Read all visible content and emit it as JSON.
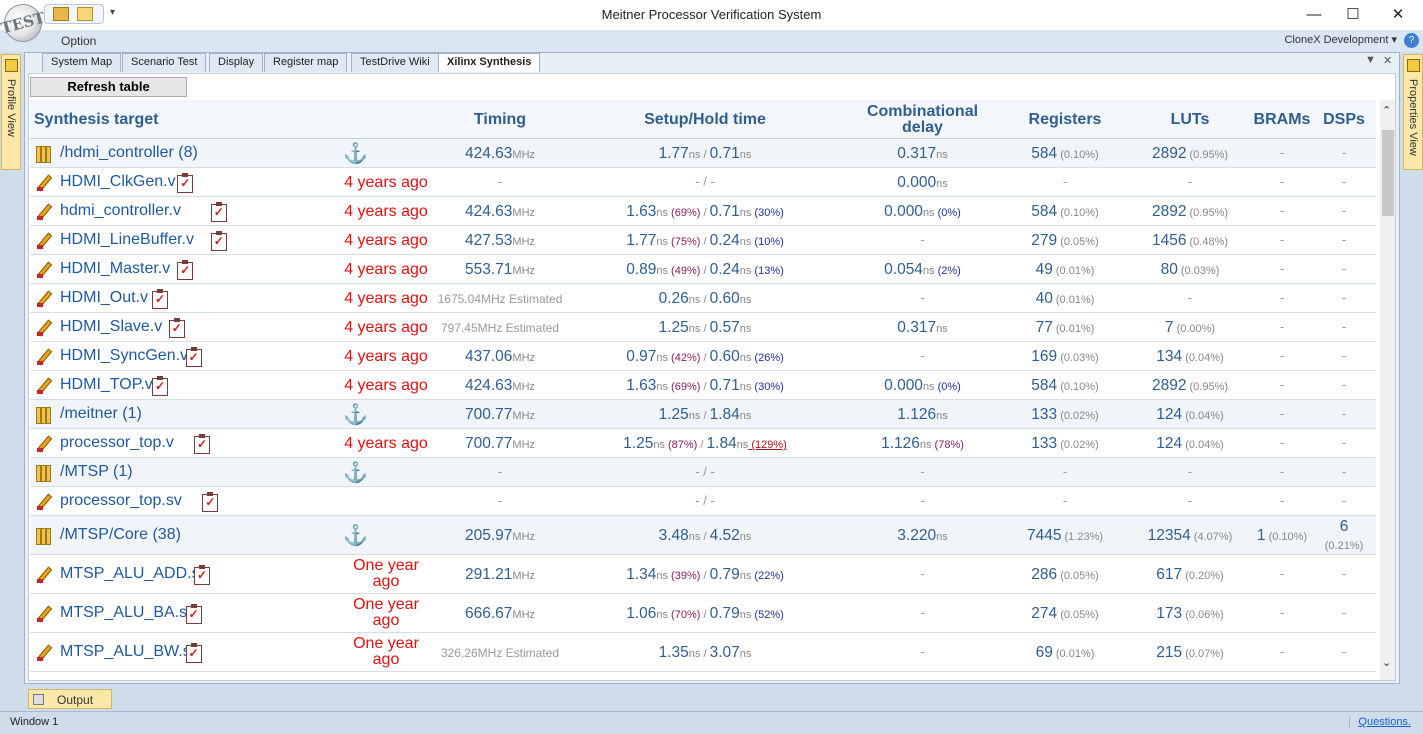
{
  "window": {
    "title": "Meitner Processor Verification System",
    "logo_text": "TEST",
    "minimize": "—",
    "maximize": "☐",
    "close": "✕"
  },
  "menubar": {
    "option": "Option",
    "profile": "CloneX Development",
    "profile_dropdown": "▾",
    "help": "?"
  },
  "side_tabs": {
    "left": "Profile View",
    "right": "Properties View"
  },
  "tabs": [
    {
      "label": "System Map"
    },
    {
      "label": "Scenario Test"
    },
    {
      "label": "Display"
    },
    {
      "label": "Register map"
    },
    {
      "label": "TestDrive Wiki"
    },
    {
      "label": "Xilinx Synthesis"
    }
  ],
  "tab_controls": {
    "dropdown": "▼",
    "close": "✕"
  },
  "refresh_label": "Refresh table",
  "columns": {
    "target": "Synthesis target",
    "timing": "Timing",
    "setup_hold": "Setup/Hold time",
    "comb_line1": "Combinational",
    "comb_line2": "delay",
    "registers": "Registers",
    "luts": "LUTs",
    "brams": "BRAMs",
    "dsps": "DSPs"
  },
  "units": {
    "mhz": "MHz",
    "ns": "ns",
    "estimated": "Estimated",
    "dash": "-",
    "slash": "/"
  },
  "rows": [
    {
      "type": "dir",
      "name": "/hdmi_controller (8)",
      "ago": "",
      "timing": "424.63",
      "setup": "1.77",
      "setup_pct": "",
      "hold": "0.71",
      "hold_pct": "",
      "comb": "0.317",
      "comb_pct": "",
      "reg": "584",
      "reg_pct": "(0.10%)",
      "lut": "2892",
      "lut_pct": "(0.95%)",
      "bram": "-",
      "bram_pct": "",
      "dsp": "-",
      "dsp_pct": ""
    },
    {
      "type": "file",
      "name": "HDMI_ClkGen.v",
      "ago": "4 years ago",
      "timing": "-",
      "setup": "-",
      "setup_pct": "",
      "hold": "-",
      "hold_pct": "",
      "comb": "0.000",
      "comb_pct": "",
      "reg": "-",
      "reg_pct": "",
      "lut": "-",
      "lut_pct": "",
      "bram": "-",
      "bram_pct": "",
      "dsp": "-",
      "dsp_pct": ""
    },
    {
      "type": "file",
      "name": "hdmi_controller.v",
      "ago": "4 years ago",
      "timing": "424.63",
      "setup": "1.63",
      "setup_pct": "(69%)",
      "hold": "0.71",
      "hold_pct": "(30%)",
      "comb": "0.000",
      "comb_pct": "(0%)",
      "reg": "584",
      "reg_pct": "(0.10%)",
      "lut": "2892",
      "lut_pct": "(0.95%)",
      "bram": "-",
      "bram_pct": "",
      "dsp": "-",
      "dsp_pct": ""
    },
    {
      "type": "file",
      "name": "HDMI_LineBuffer.v",
      "ago": "4 years ago",
      "timing": "427.53",
      "setup": "1.77",
      "setup_pct": "(75%)",
      "hold": "0.24",
      "hold_pct": "(10%)",
      "comb": "-",
      "comb_pct": "",
      "reg": "279",
      "reg_pct": "(0.05%)",
      "lut": "1456",
      "lut_pct": "(0.48%)",
      "bram": "-",
      "bram_pct": "",
      "dsp": "-",
      "dsp_pct": ""
    },
    {
      "type": "file",
      "name": "HDMI_Master.v",
      "ago": "4 years ago",
      "timing": "553.71",
      "setup": "0.89",
      "setup_pct": "(49%)",
      "hold": "0.24",
      "hold_pct": "(13%)",
      "comb": "0.054",
      "comb_pct": "(2%)",
      "reg": "49",
      "reg_pct": "(0.01%)",
      "lut": "80",
      "lut_pct": "(0.03%)",
      "bram": "-",
      "bram_pct": "",
      "dsp": "-",
      "dsp_pct": ""
    },
    {
      "type": "file",
      "name": "HDMI_Out.v",
      "ago": "4 years ago",
      "timing": "1675.04",
      "timing_est": true,
      "setup": "0.26",
      "setup_pct": "",
      "hold": "0.60",
      "hold_pct": "",
      "comb": "-",
      "comb_pct": "",
      "reg": "40",
      "reg_pct": "(0.01%)",
      "lut": "-",
      "lut_pct": "",
      "bram": "-",
      "bram_pct": "",
      "dsp": "-",
      "dsp_pct": ""
    },
    {
      "type": "file",
      "name": "HDMI_Slave.v",
      "ago": "4 years ago",
      "timing": "797.45",
      "timing_est": true,
      "setup": "1.25",
      "setup_pct": "",
      "hold": "0.57",
      "hold_pct": "",
      "comb": "0.317",
      "comb_pct": "",
      "reg": "77",
      "reg_pct": "(0.01%)",
      "lut": "7",
      "lut_pct": "(0.00%)",
      "bram": "-",
      "bram_pct": "",
      "dsp": "-",
      "dsp_pct": ""
    },
    {
      "type": "file",
      "name": "HDMI_SyncGen.v",
      "ago": "4 years ago",
      "timing": "437.06",
      "setup": "0.97",
      "setup_pct": "(42%)",
      "hold": "0.60",
      "hold_pct": "(26%)",
      "comb": "-",
      "comb_pct": "",
      "reg": "169",
      "reg_pct": "(0.03%)",
      "lut": "134",
      "lut_pct": "(0.04%)",
      "bram": "-",
      "bram_pct": "",
      "dsp": "-",
      "dsp_pct": ""
    },
    {
      "type": "file",
      "name": "HDMI_TOP.v",
      "ago": "4 years ago",
      "timing": "424.63",
      "setup": "1.63",
      "setup_pct": "(69%)",
      "hold": "0.71",
      "hold_pct": "(30%)",
      "comb": "0.000",
      "comb_pct": "(0%)",
      "reg": "584",
      "reg_pct": "(0.10%)",
      "lut": "2892",
      "lut_pct": "(0.95%)",
      "bram": "-",
      "bram_pct": "",
      "dsp": "-",
      "dsp_pct": ""
    },
    {
      "type": "dir",
      "name": "/meitner (1)",
      "ago": "",
      "timing": "700.77",
      "setup": "1.25",
      "setup_pct": "",
      "hold": "1.84",
      "hold_pct": "",
      "comb": "1.126",
      "comb_pct": "",
      "reg": "133",
      "reg_pct": "(0.02%)",
      "lut": "124",
      "lut_pct": "(0.04%)",
      "bram": "-",
      "bram_pct": "",
      "dsp": "-",
      "dsp_pct": ""
    },
    {
      "type": "file",
      "name": "processor_top.v",
      "ago": "4 years ago",
      "timing": "700.77",
      "setup": "1.25",
      "setup_pct": "(87%)",
      "hold": "1.84",
      "hold_pct": "(129%)",
      "hold_over": true,
      "comb": "1.126",
      "comb_pct": "(78%)",
      "reg": "133",
      "reg_pct": "(0.02%)",
      "lut": "124",
      "lut_pct": "(0.04%)",
      "bram": "-",
      "bram_pct": "",
      "dsp": "-",
      "dsp_pct": ""
    },
    {
      "type": "dir",
      "name": "/MTSP (1)",
      "ago": "",
      "timing": "-",
      "setup": "-",
      "setup_pct": "",
      "hold": "-",
      "hold_pct": "",
      "comb": "-",
      "comb_pct": "",
      "reg": "-",
      "reg_pct": "",
      "lut": "-",
      "lut_pct": "",
      "bram": "-",
      "bram_pct": "",
      "dsp": "-",
      "dsp_pct": ""
    },
    {
      "type": "file",
      "name": "processor_top.sv",
      "ago": "",
      "timing": "-",
      "setup": "-",
      "setup_pct": "",
      "hold": "-",
      "hold_pct": "",
      "comb": "-",
      "comb_pct": "",
      "reg": "-",
      "reg_pct": "",
      "lut": "-",
      "lut_pct": "",
      "bram": "-",
      "bram_pct": "",
      "dsp": "-",
      "dsp_pct": ""
    },
    {
      "type": "dir",
      "name": "/MTSP/Core (38)",
      "ago": "",
      "timing": "205.97",
      "setup": "3.48",
      "setup_pct": "",
      "hold": "4.52",
      "hold_pct": "",
      "comb": "3.220",
      "comb_pct": "",
      "reg": "7445",
      "reg_pct": "(1.23%)",
      "lut": "12354",
      "lut_pct": "(4.07%)",
      "bram": "1",
      "bram_pct": "(0.10%)",
      "dsp": "6",
      "dsp_pct": "(0.21%)",
      "tall": true
    },
    {
      "type": "file",
      "name": "MTSP_ALU_ADD.sv",
      "ago": "One year ago",
      "timing": "291.21",
      "setup": "1.34",
      "setup_pct": "(39%)",
      "hold": "0.79",
      "hold_pct": "(22%)",
      "comb": "-",
      "comb_pct": "",
      "reg": "286",
      "reg_pct": "(0.05%)",
      "lut": "617",
      "lut_pct": "(0.20%)",
      "bram": "-",
      "bram_pct": "",
      "dsp": "-",
      "dsp_pct": "",
      "tall": true
    },
    {
      "type": "file",
      "name": "MTSP_ALU_BA.sv",
      "ago": "One year ago",
      "timing": "666.67",
      "setup": "1.06",
      "setup_pct": "(70%)",
      "hold": "0.79",
      "hold_pct": "(52%)",
      "comb": "-",
      "comb_pct": "",
      "reg": "274",
      "reg_pct": "(0.05%)",
      "lut": "173",
      "lut_pct": "(0.06%)",
      "bram": "-",
      "bram_pct": "",
      "dsp": "-",
      "dsp_pct": "",
      "tall": true
    },
    {
      "type": "file",
      "name": "MTSP_ALU_BW.sv",
      "ago": "One year ago",
      "timing": "326.26",
      "timing_est": true,
      "setup": "1.35",
      "setup_pct": "",
      "hold": "3.07",
      "hold_pct": "",
      "comb": "-",
      "comb_pct": "",
      "reg": "69",
      "reg_pct": "(0.01%)",
      "lut": "215",
      "lut_pct": "(0.07%)",
      "bram": "-",
      "bram_pct": "",
      "dsp": "-",
      "dsp_pct": "",
      "tall": true
    }
  ],
  "scroll": {
    "up": "⌃",
    "down": "⌄"
  },
  "output_tab": "Output",
  "status": {
    "window": "Window 1",
    "questions": "Questions."
  }
}
